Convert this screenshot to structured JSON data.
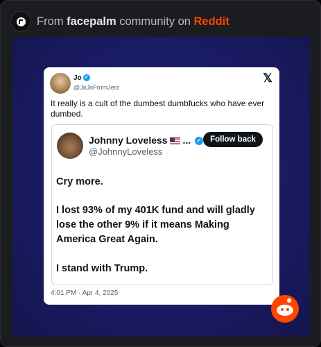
{
  "header": {
    "prefix": "From ",
    "community": "facepalm",
    "middle": " community on ",
    "platform": "Reddit"
  },
  "tweet": {
    "author_name": "Jo",
    "author_handle": "@JoJoFromJerz",
    "text": "It really is a cult of the dumbest dumbfucks who have ever dumbed.",
    "timestamp": "4:01 PM · Apr 4, 2025"
  },
  "quote": {
    "author_name": "Johnny Loveless",
    "name_suffix": "...",
    "author_handle": "@JohnnyLoveless",
    "follow_label": "Follow back",
    "line1": "Cry more.",
    "line2": "I lost 93% of my 401K fund and will gladly lose the other 9% if it means Making America Great Again.",
    "line3": "I stand with Trump."
  },
  "icons": {
    "community": "facepalm-community-icon",
    "verified": "verified-badge-icon",
    "x_logo": "x-logo-icon",
    "flag": "us-flag-icon",
    "reddit": "reddit-snoo-icon"
  },
  "colors": {
    "reddit_orange": "#ff4500",
    "verified_blue": "#1d9bf0",
    "media_bg": "#1a1b64"
  }
}
